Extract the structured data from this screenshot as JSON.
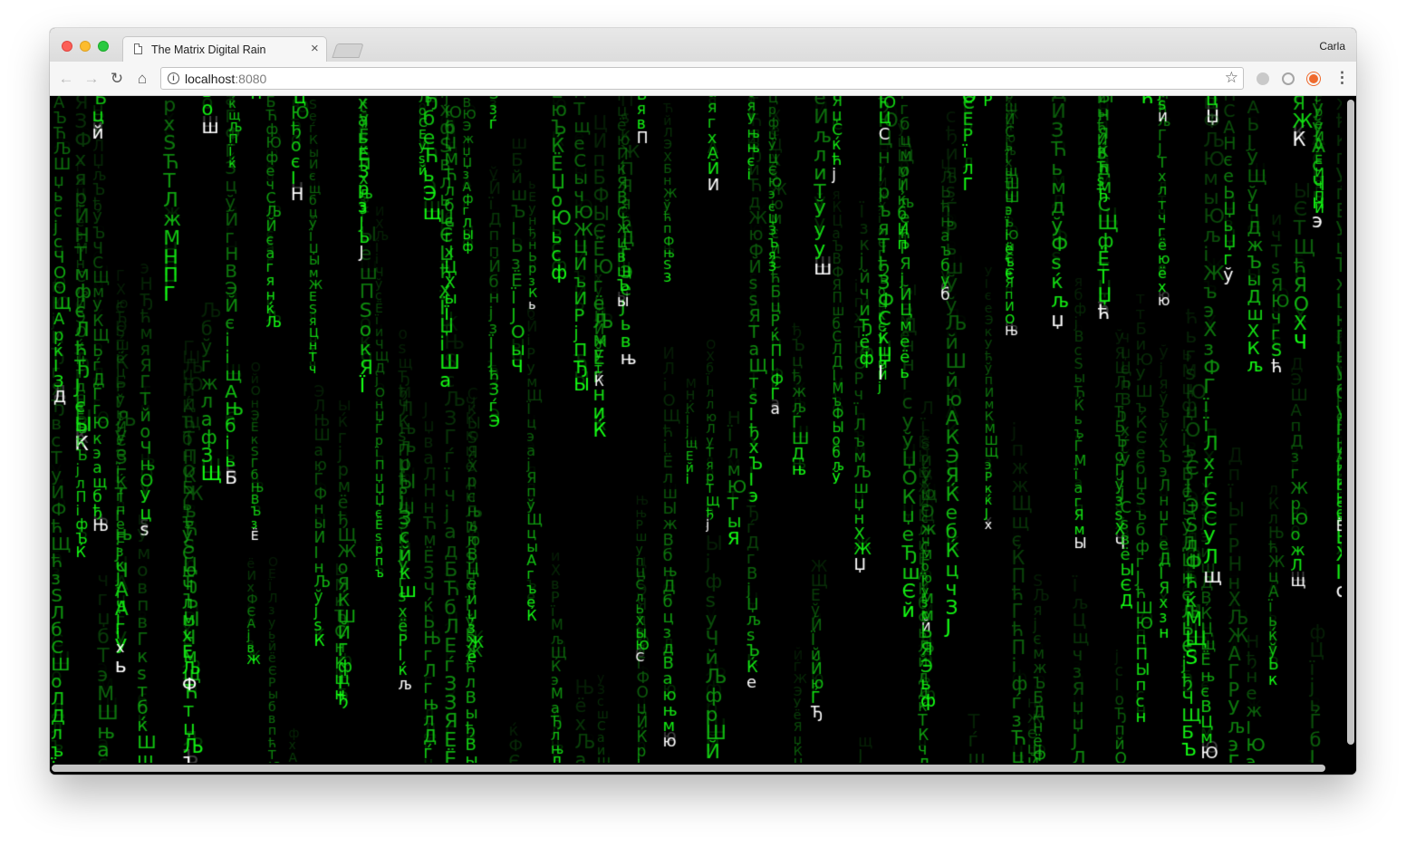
{
  "browser": {
    "tab_title": "The Matrix Digital Rain",
    "tab_close": "×",
    "profile_name": "Carla",
    "url_host": "localhost",
    "url_port": ":8080"
  },
  "icons": {
    "back": "back-arrow-icon",
    "forward": "forward-arrow-icon",
    "reload": "reload-icon",
    "home": "home-icon",
    "info": "info-icon",
    "bookmark": "star-icon",
    "menu": "kebab-menu-icon"
  },
  "matrix": {
    "glyphs": "АБВГДЕЁЖЗИЙКЛМНОПРСТУФХЦЧШЩЪЫЬЭЮЯабвгдеёжзийклмнопрстуфхцчшщъыьэюяЂЃЄЅІЇЈЉЊЋЌЎЏђѓєѕіїјљњћќўџ",
    "color_bright": "#33ff33",
    "color_head": "#ffffff",
    "color_background": "#000000"
  }
}
